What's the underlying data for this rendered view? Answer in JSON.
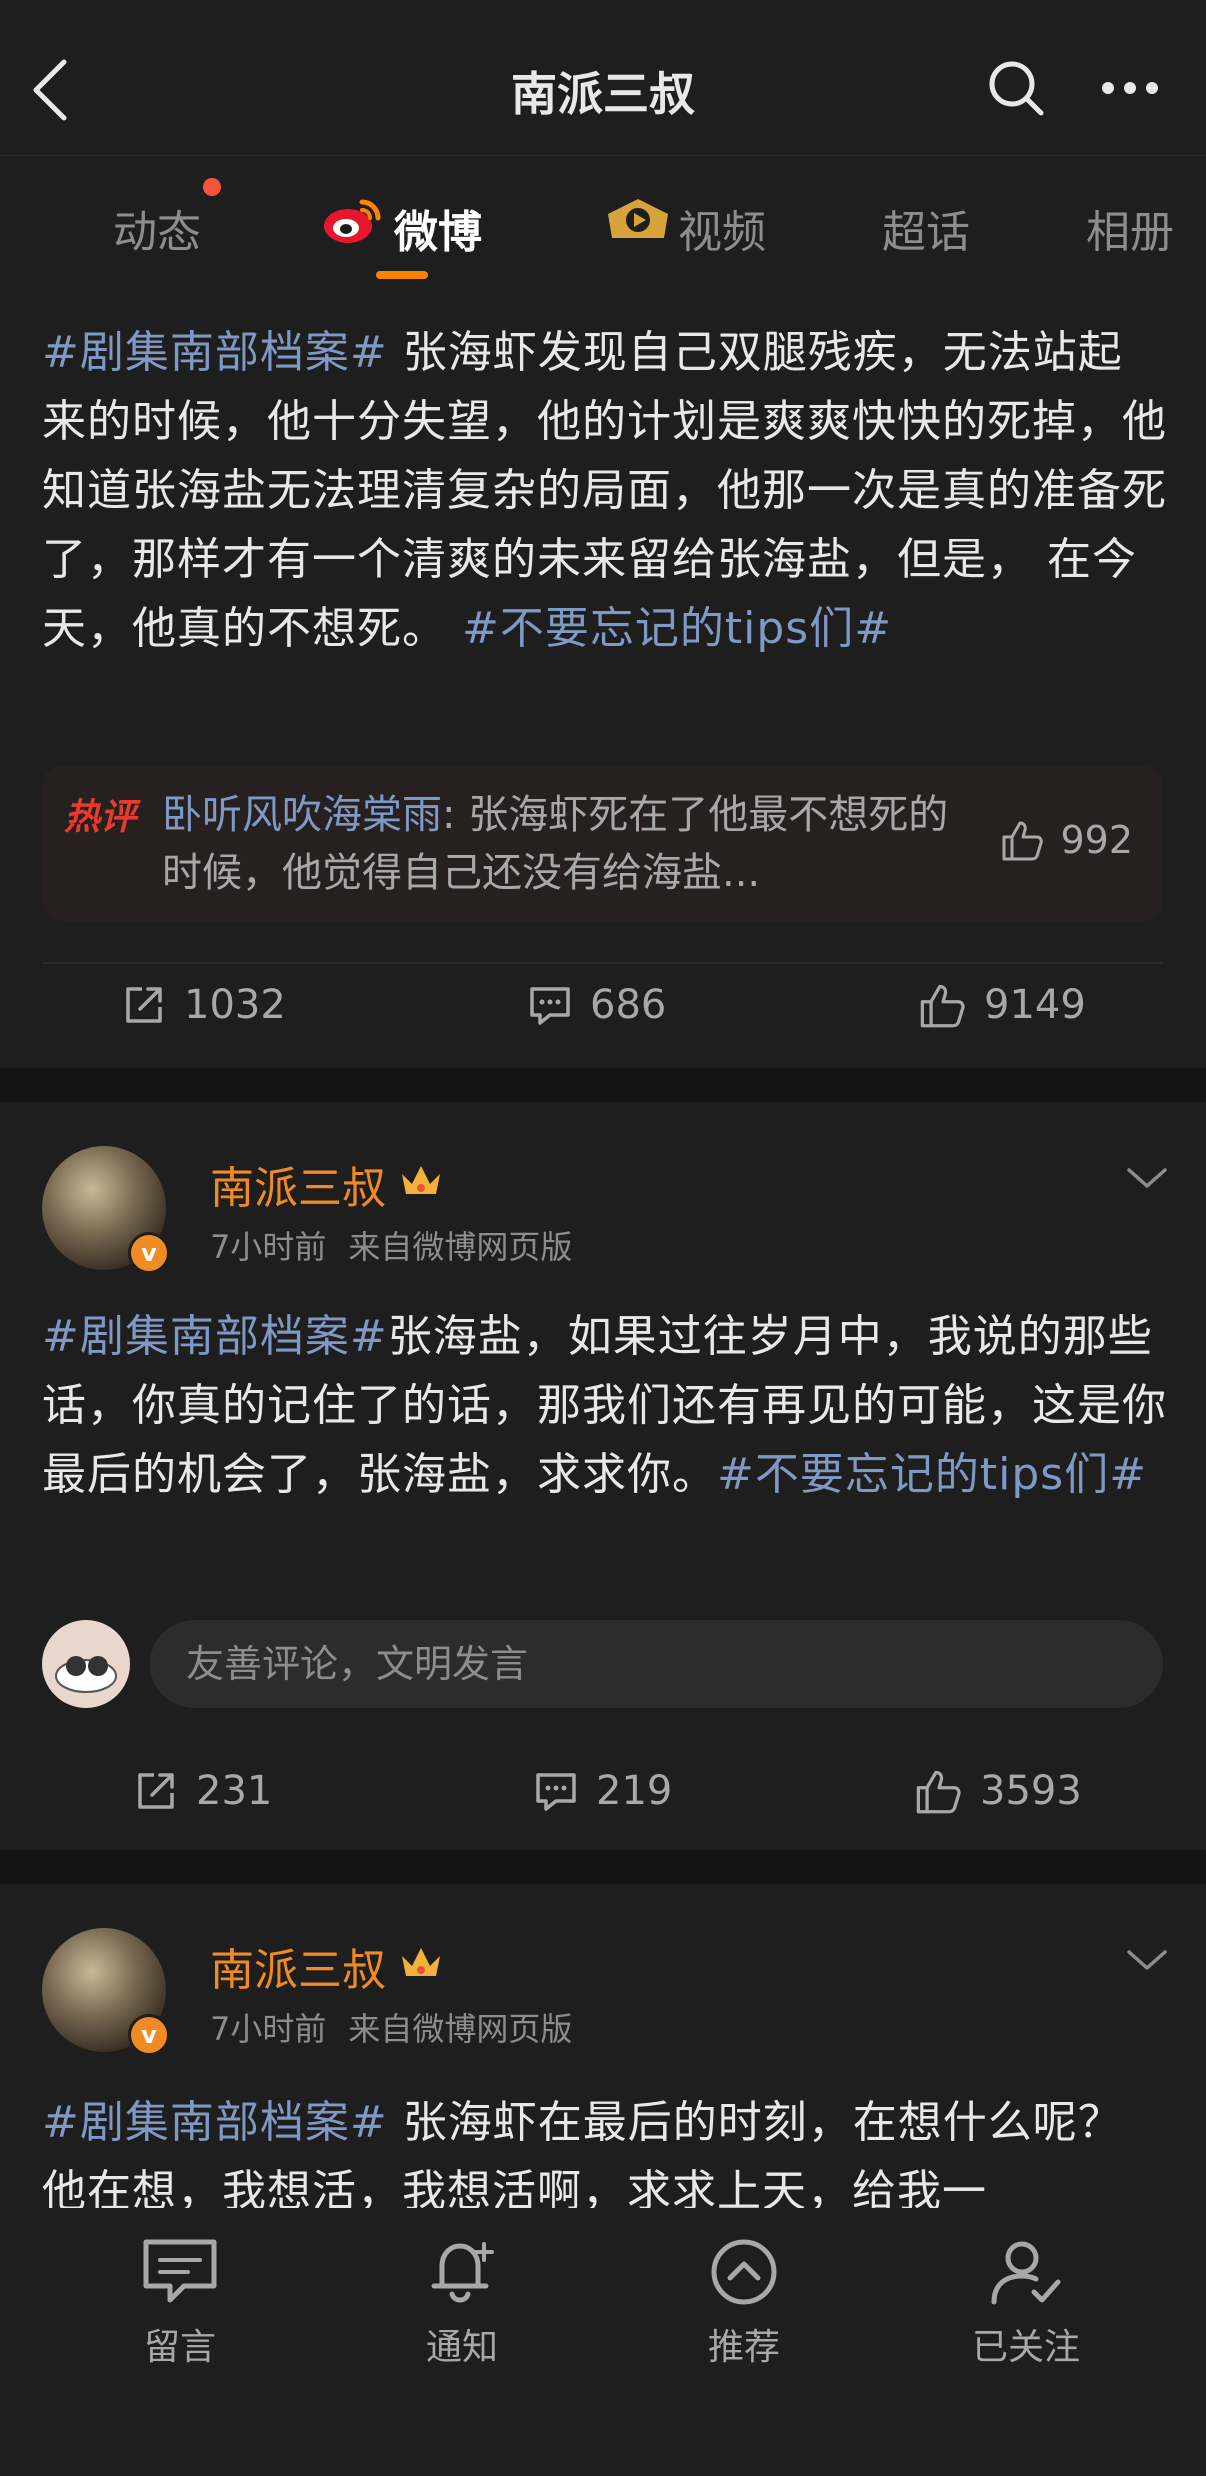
{
  "header": {
    "title": "南派三叔"
  },
  "tabs": [
    {
      "label": "动态"
    },
    {
      "label": "微博"
    },
    {
      "label": "视频"
    },
    {
      "label": "超话"
    },
    {
      "label": "相册"
    }
  ],
  "posts": [
    {
      "topic": "#剧集南部档案#",
      "text": " 张海虾发现自己双腿残疾，无法站起来的时候，他十分失望，他的计划是爽爽快快的死掉，他知道张海盐无法理清复杂的局面，他那一次是真的准备死了，那样才有一个清爽的未来留给张海盐，但是， 在今天，他真的不想死。 ",
      "topic2": "#不要忘记的tips们#",
      "hot_comment": {
        "badge": "热评",
        "user": "卧听风吹海棠雨",
        "text": ": 张海虾死在了他最不想死的时候，他觉得自己还没有给海盐...",
        "likes": "992"
      },
      "reposts": "1032",
      "comments": "686",
      "likes": "9149"
    },
    {
      "author": "南派三叔",
      "time": "7小时前",
      "source": "来自微博网页版",
      "topic": "#剧集南部档案#",
      "text": "张海盐，如果过往岁月中，我说的那些话，你真的记住了的话，那我们还有再见的可能，这是你最后的机会了，张海盐，求求你。",
      "topic2": "#不要忘记的tips们#",
      "comment_placeholder": "友善评论，文明发言",
      "reposts": "231",
      "comments": "219",
      "likes": "3593"
    },
    {
      "author": "南派三叔",
      "time": "7小时前",
      "source": "来自微博网页版",
      "topic": "#剧集南部档案#",
      "text": " 张海虾在最后的时刻，在想什么呢？他在想，我想活，我想活啊，求求上天，给我一"
    }
  ],
  "bottom_nav": [
    {
      "label": "留言",
      "icon": "message-icon"
    },
    {
      "label": "通知",
      "icon": "bell-icon"
    },
    {
      "label": "推荐",
      "icon": "recommend-icon"
    },
    {
      "label": "已关注",
      "icon": "followed-user-icon"
    }
  ],
  "colors": {
    "accent": "#ff8200",
    "username": "#f08a24",
    "topic": "#7f98c4",
    "background": "#141414",
    "card": "#1e1e1e"
  }
}
